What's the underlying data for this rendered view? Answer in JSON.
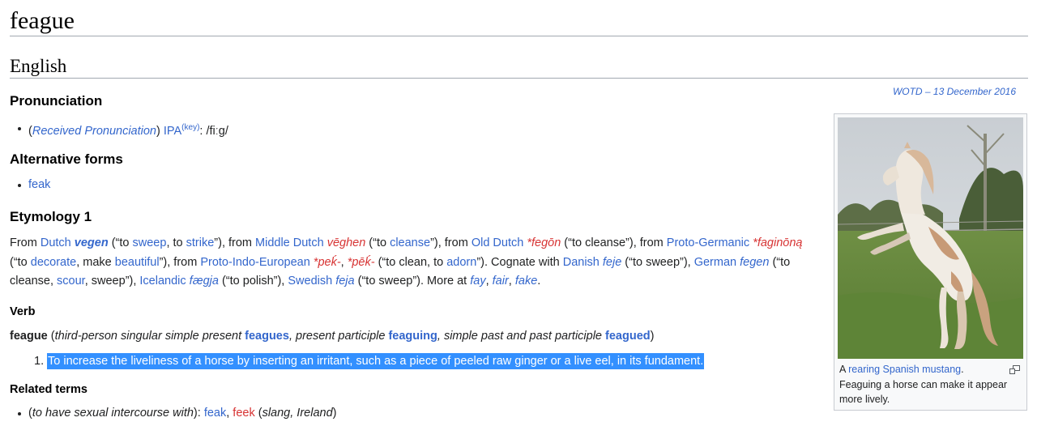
{
  "page": {
    "title": "feague"
  },
  "language": {
    "heading": "English"
  },
  "pronunciation": {
    "heading": "Pronunciation",
    "open_paren": "(",
    "accent": "Received Pronunciation",
    "close_paren": ")",
    "ipa_label": "IPA",
    "ipa_key": "(key)",
    "colon": ":",
    "ipa": "/fiːg/"
  },
  "alternative_forms": {
    "heading": "Alternative forms",
    "items": [
      "feak"
    ]
  },
  "etymology": {
    "heading": "Etymology 1",
    "segments": [
      {
        "t": "From "
      },
      {
        "t": "Dutch",
        "c": "link"
      },
      {
        "t": " "
      },
      {
        "t": "vegen",
        "c": "link b i"
      },
      {
        "t": " (“to "
      },
      {
        "t": "sweep",
        "c": "link"
      },
      {
        "t": ", to "
      },
      {
        "t": "strike",
        "c": "link"
      },
      {
        "t": "”), from "
      },
      {
        "t": "Middle Dutch",
        "c": "link"
      },
      {
        "t": " "
      },
      {
        "t": "vēghen",
        "c": "red i"
      },
      {
        "t": " (“to "
      },
      {
        "t": "cleanse",
        "c": "link"
      },
      {
        "t": "”), from "
      },
      {
        "t": "Old Dutch",
        "c": "link"
      },
      {
        "t": " "
      },
      {
        "t": "*fegōn",
        "c": "red i"
      },
      {
        "t": " (“to cleanse”), from "
      },
      {
        "t": "Proto-Germanic",
        "c": "link"
      },
      {
        "t": " "
      },
      {
        "t": "*faginōną",
        "c": "red i"
      },
      {
        "t": " (“to "
      },
      {
        "t": "decorate",
        "c": "link"
      },
      {
        "t": ", make "
      },
      {
        "t": "beautiful",
        "c": "link"
      },
      {
        "t": "”), from "
      },
      {
        "t": "Proto-Indo-European",
        "c": "link"
      },
      {
        "t": " "
      },
      {
        "t": "*peḱ-",
        "c": "red i"
      },
      {
        "t": ", "
      },
      {
        "t": "*pēḱ-",
        "c": "red i"
      },
      {
        "t": " (“to clean, to "
      },
      {
        "t": "adorn",
        "c": "link"
      },
      {
        "t": "”). Cognate with "
      },
      {
        "t": "Danish",
        "c": "link"
      },
      {
        "t": " "
      },
      {
        "t": "feje",
        "c": "link i"
      },
      {
        "t": " (“to sweep”), "
      },
      {
        "t": "German",
        "c": "link"
      },
      {
        "t": " "
      },
      {
        "t": "fegen",
        "c": "link i"
      },
      {
        "t": " (“to cleanse, "
      },
      {
        "t": "scour",
        "c": "link"
      },
      {
        "t": ", sweep”), "
      },
      {
        "t": "Icelandic",
        "c": "link"
      },
      {
        "t": " "
      },
      {
        "t": "fægja",
        "c": "link i"
      },
      {
        "t": " (“to polish”), "
      },
      {
        "t": "Swedish",
        "c": "link"
      },
      {
        "t": " "
      },
      {
        "t": "feja",
        "c": "link i"
      },
      {
        "t": " (“to sweep”). More at "
      },
      {
        "t": "fay",
        "c": "link i"
      },
      {
        "t": ", "
      },
      {
        "t": "fair",
        "c": "link i"
      },
      {
        "t": ", "
      },
      {
        "t": "fake",
        "c": "link i"
      },
      {
        "t": "."
      }
    ]
  },
  "verb": {
    "heading": "Verb",
    "headword": "feague",
    "open_paren": " (",
    "tps_label": "third-person singular simple present",
    "tps_form": "feagues",
    "pp_label": ", present participle",
    "pp_form": "feaguing",
    "past_label": ", simple past and past participle",
    "past_form": "feagued",
    "close_paren": ")",
    "definition_number": "1.",
    "definition": "To increase the liveliness of a horse by inserting an irritant, such as a piece of peeled raw ginger or a live eel, in its fundament."
  },
  "related_terms": {
    "heading": "Related terms",
    "open_paren": "(",
    "sense": "to have sexual intercourse with",
    "after_sense": "): ",
    "term1": "feak",
    "sep": ", ",
    "term2": "feek",
    "note_open": " (",
    "note": "slang, Ireland",
    "note_close": ")"
  },
  "sidebar": {
    "wotd": "WOTD – 13 December 2016",
    "caption_prefix": "A ",
    "caption_link1": "rearing",
    "caption_space": " ",
    "caption_link2": "Spanish mustang",
    "caption_dot": ".",
    "caption_rest": "Feaguing a horse can make it appear more lively."
  },
  "colors": {
    "link": "#3366cc",
    "redlink": "#d73333",
    "selection": "#3390ff"
  },
  "icons": {
    "thumb_magnify": "magnify-clip-icon"
  }
}
